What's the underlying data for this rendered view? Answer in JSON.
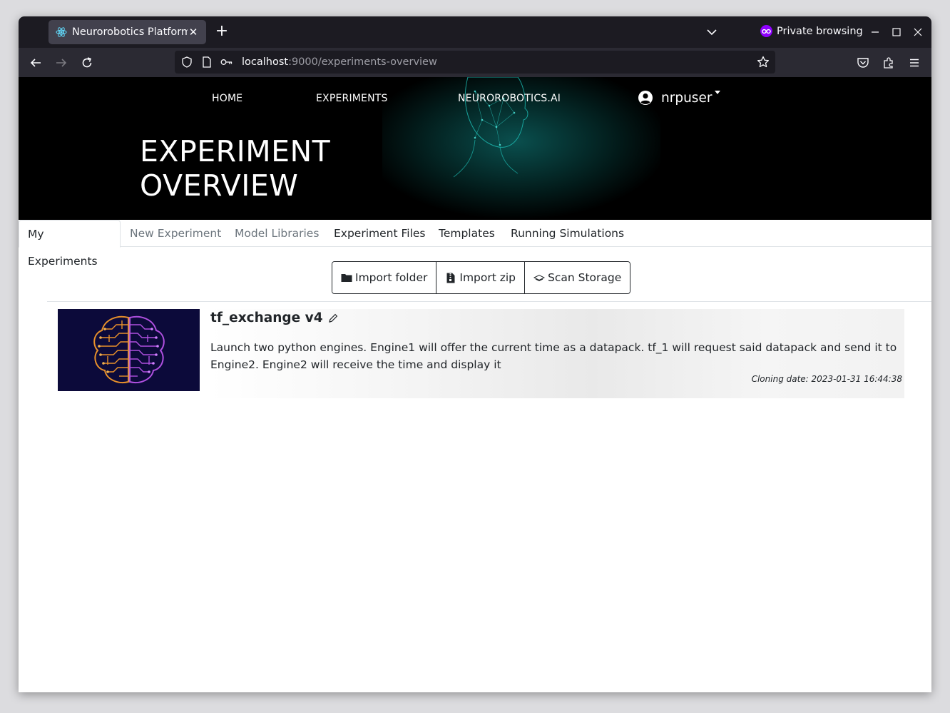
{
  "browser": {
    "tab_title": "Neurorobotics Platform",
    "private_label": "Private browsing",
    "url_host": "localhost",
    "url_rest": ":9000/experiments-overview"
  },
  "header": {
    "nav": [
      "HOME",
      "EXPERIMENTS",
      "NEUROROBOTICS.AI"
    ],
    "username": "nrpuser",
    "title_line1": "EXPERIMENT",
    "title_line2": "OVERVIEW"
  },
  "tabs": [
    {
      "label": "My Experiments",
      "state": "active"
    },
    {
      "label": "New Experiment",
      "state": "disabled"
    },
    {
      "label": "Model Libraries",
      "state": "disabled"
    },
    {
      "label": "Experiment Files",
      "state": "normal"
    },
    {
      "label": "Templates",
      "state": "normal"
    },
    {
      "label": "Running Simulations",
      "state": "normal"
    }
  ],
  "actions": {
    "import_folder": "Import folder",
    "import_zip": "Import zip",
    "scan_storage": "Scan Storage"
  },
  "experiment": {
    "title": "tf_exchange v4",
    "description": "Launch two python engines. Engine1 will offer the current time as a datapack. tf_1 will request said datapack and send it to Engine2. Engine2 will receive the time and display it",
    "cloning_date": "Cloning date: 2023-01-31 16:44:38"
  },
  "colors": {
    "accent_private": "#8f00ff",
    "hero_teal": "#1fc9c0",
    "brain_orange": "#e8902a",
    "brain_purple": "#b050e0"
  }
}
